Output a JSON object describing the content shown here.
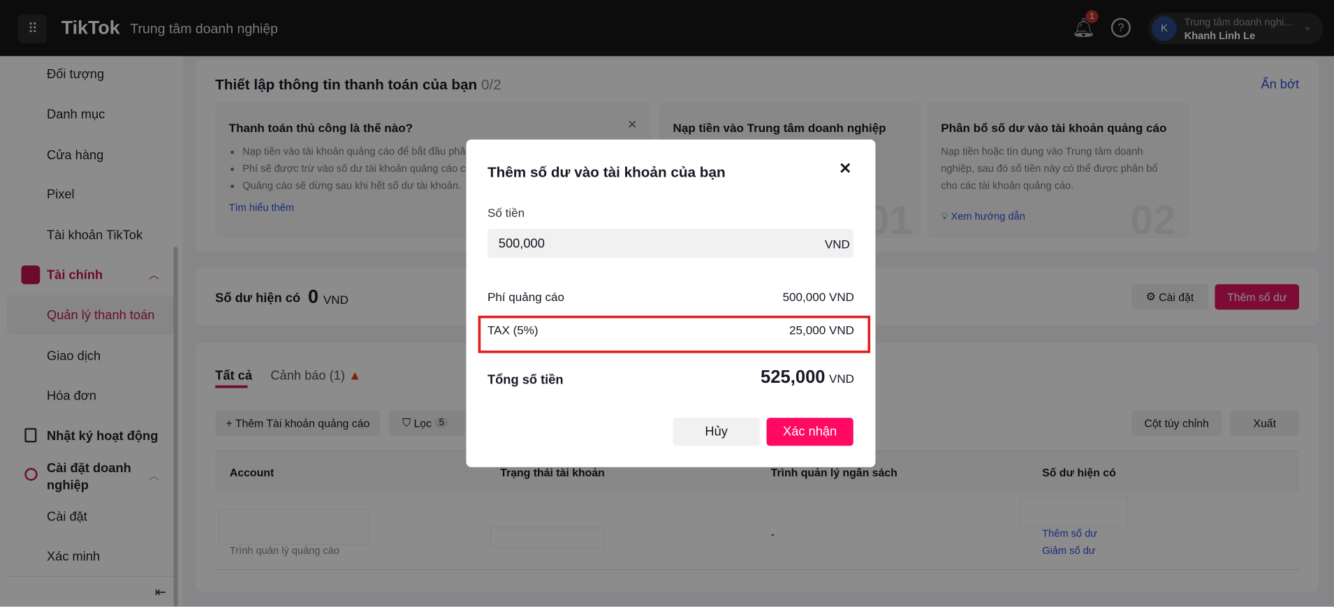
{
  "header": {
    "brand": "TikTok",
    "subtitle": "Trung tâm doanh nghiệp",
    "notification_count": "1",
    "account_org": "Trung tâm doanh nghi...",
    "account_name": "Khanh Linh Le",
    "avatar_letter": "K"
  },
  "sidebar": {
    "items": [
      "Đối tượng",
      "Danh mục",
      "Cửa hàng",
      "Pixel",
      "Tài khoản TikTok"
    ],
    "finance": "Tài chính",
    "finance_items": [
      "Quản lý thanh toán",
      "Giao dịch",
      "Hóa đơn"
    ],
    "activity_log": "Nhật ký hoạt động",
    "biz_settings_1": "Cài đặt doanh",
    "biz_settings_2": "nghiệp",
    "biz_items": [
      "Cài đặt",
      "Xác minh"
    ]
  },
  "setup": {
    "title": "Thiết lập thông tin thanh toán của bạn",
    "progress": "0/2",
    "hide": "Ẩn bớt",
    "card1": {
      "title": "Thanh toán thủ công là thế nào?",
      "bullets": [
        "Nạp tiền vào tài khoản quảng cáo để bắt đầu phân phối quảng cáo.",
        "Phí sẽ được trừ vào số dư tài khoản quảng cáo của bạn khi quảng cáo.",
        "Quảng cáo sẽ dừng sau khi hết số dư tài khoản."
      ],
      "link": "Tìm hiểu thêm"
    },
    "card2": {
      "title": "Nạp tiền vào Trung tâm doanh nghiệp",
      "number": "01"
    },
    "card3": {
      "title": "Phân bổ số dư vào tài khoản quảng cáo",
      "text": "Nạp tiền hoặc tín dụng vào Trung tâm doanh nghiệp, sau đó số tiền này có thể được phân bổ cho các tài khoản quảng cáo.",
      "link": "Xem hướng dẫn",
      "number": "02"
    }
  },
  "balance": {
    "label": "Số dư hiện có",
    "value": "0",
    "currency": "VND",
    "settings": "Cài đặt",
    "add": "Thêm số dư"
  },
  "tabs": {
    "all": "Tất cả",
    "warning": "Cảnh báo (1)"
  },
  "toolbar": {
    "add_account": "+ Thêm Tài khoản quảng cáo",
    "filter": "Lọc",
    "filter_count": "5",
    "columns": "Cột tùy chỉnh",
    "export": "Xuất"
  },
  "table": {
    "headers": [
      "Account",
      "Trạng thái tài khoản",
      "Trình quản lý ngân sách",
      "Số dư hiện có"
    ],
    "row": {
      "role": "Trình quản lý quảng cáo",
      "budget": "-",
      "add": "Thêm số dư",
      "reduce": "Giảm số dư"
    }
  },
  "modal": {
    "title": "Thêm số dư vào tài khoản của bạn",
    "amount_label": "Số tiền",
    "amount_value": "500,000",
    "amount_currency": "VND",
    "fee_label": "Phí quảng cáo",
    "fee_value": "500,000 VND",
    "tax_label": "TAX (5%)",
    "tax_value": "25,000 VND",
    "total_label": "Tổng số tiền",
    "total_value": "525,000",
    "total_currency": "VND",
    "cancel": "Hủy",
    "confirm": "Xác nhận",
    "highlight_color": "#e02020"
  }
}
